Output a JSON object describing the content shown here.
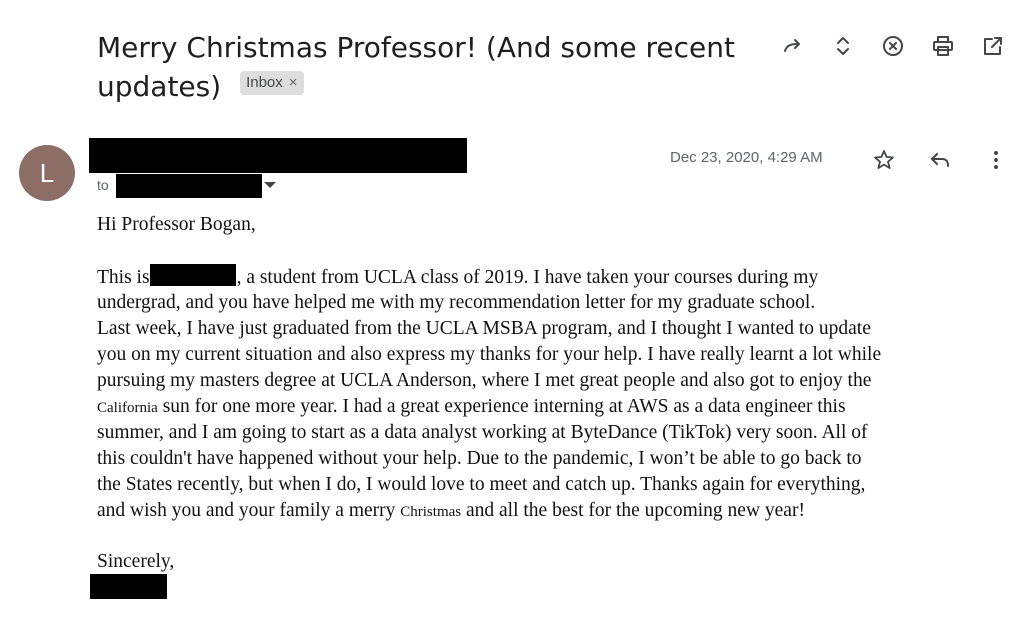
{
  "email": {
    "subject": "Merry Christmas Professor! (And some recent updates)",
    "label_chip": "Inbox",
    "label_chip_close": "×",
    "sender_initial": "L",
    "to_label": "to",
    "date": "Dec 23, 2020, 4:29 AM",
    "greeting": "Hi Professor Bogan,",
    "body_lines": [
      [
        "This is",
        ", a student from UCLA class of 2019. I have taken your courses during my"
      ],
      [
        "undergrad, and you have helped me with my recommendation letter for my graduate school."
      ],
      [
        "Last week, I have just graduated from the UCLA MSBA program, and I thought I wanted to update"
      ],
      [
        "you on my current situation and also express my thanks for your help. I have really learnt a lot while"
      ],
      [
        "pursuing my masters degree at UCLA Anderson, where I met great people and also got to enjoy the"
      ],
      [
        "California",
        " sun for one more year. I had a great experience interning at AWS as a data engineer this"
      ],
      [
        "summer, and I am going to start as a data analyst working at ByteDance (TikTok) very soon.  All of"
      ],
      [
        "this couldn't have happened without your help.  Due to the pandemic, I won’t be able to go back to"
      ],
      [
        "the States recently, but when I do, I would love to meet and catch up. Thanks again for everything,"
      ],
      [
        "and wish you and your family a merry ",
        "Christmas",
        " and all the best for the upcoming new year!"
      ]
    ],
    "signoff": "Sincerely,"
  },
  "icons": {
    "top": [
      "forward-icon",
      "expand-icon",
      "close-circle-icon",
      "print-icon",
      "open-new-window-icon"
    ],
    "meta": [
      "star-icon",
      "reply-icon",
      "more-vert-icon"
    ]
  },
  "colors": {
    "avatar_bg": "#8c6e67",
    "chip_bg": "#dddddd",
    "redaction": "#000000"
  }
}
